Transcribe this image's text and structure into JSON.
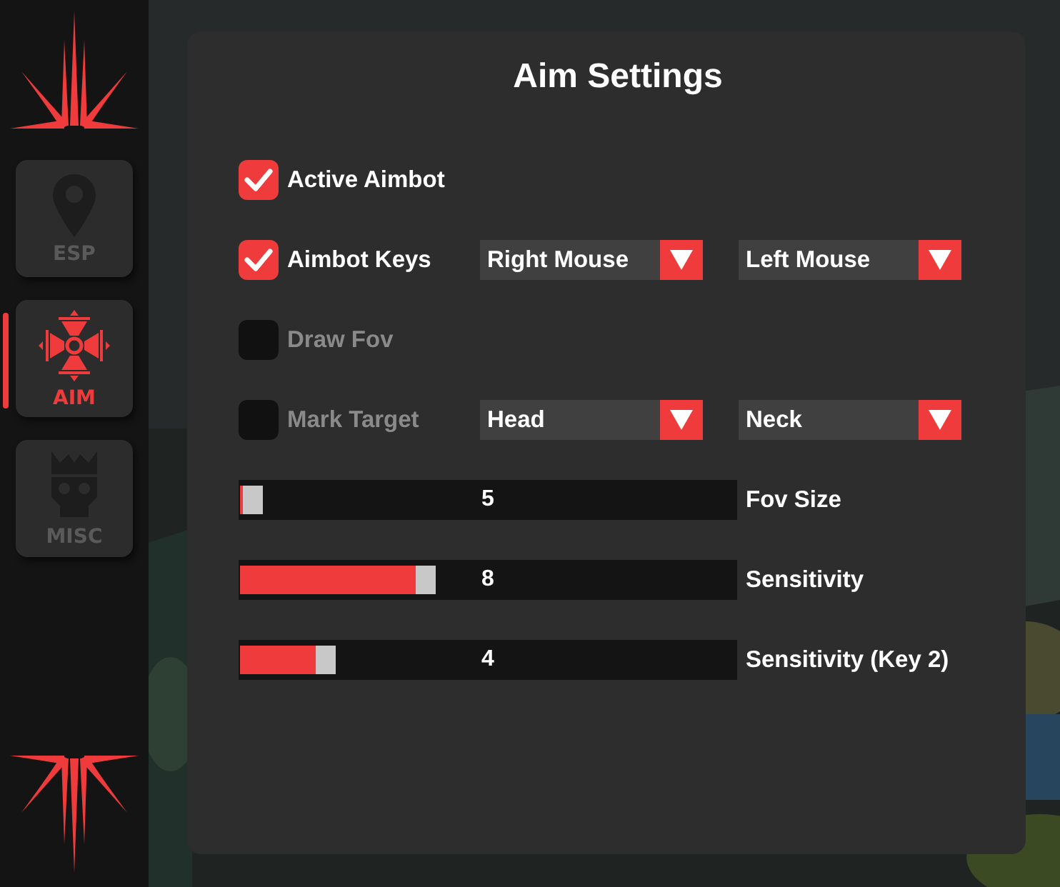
{
  "sidebar": {
    "tabs": [
      {
        "label": "ESP",
        "kind": "pin",
        "selected": false
      },
      {
        "label": "AIM",
        "kind": "crosshair",
        "selected": true
      },
      {
        "label": "MISC",
        "kind": "skull",
        "selected": false
      }
    ]
  },
  "panel": {
    "title": "Aim Settings",
    "options": [
      {
        "label": "Active Aimbot",
        "checked": true
      },
      {
        "label": "Aimbot Keys",
        "checked": true,
        "dropdowns": [
          "Right Mouse",
          "Left Mouse"
        ]
      },
      {
        "label": "Draw Fov",
        "checked": false
      },
      {
        "label": "Mark Target",
        "checked": false,
        "dropdowns": [
          "Head",
          "Neck"
        ]
      }
    ],
    "sliders": [
      {
        "value": "5",
        "label": "Fov Size",
        "level": 0.005
      },
      {
        "value": "8",
        "label": "Sensitivity",
        "level": 0.37
      },
      {
        "value": "4",
        "label": "Sensitivity (Key 2)",
        "level": 0.16
      }
    ]
  }
}
